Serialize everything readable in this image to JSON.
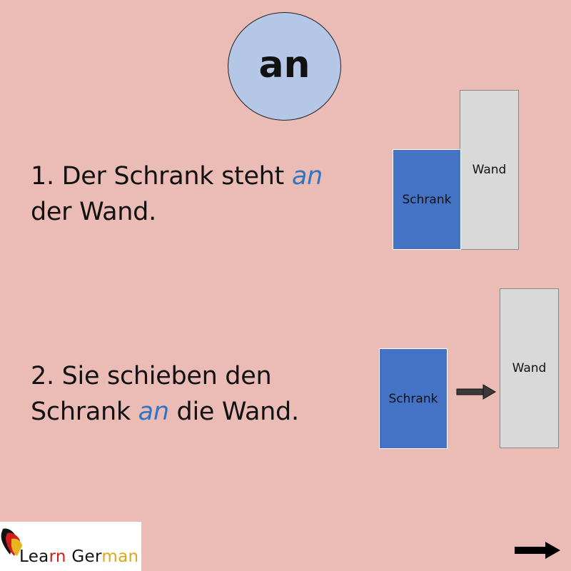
{
  "title": "an",
  "sentence1": {
    "number": "1.",
    "before": "Der Schrank steht",
    "keyword": "an",
    "after": "der Wand."
  },
  "sentence2": {
    "number": "2.",
    "before_line1": "Sie schieben den",
    "before_line2": "Schrank",
    "keyword": "an",
    "after": "die Wand."
  },
  "diagram1": {
    "schrank_label": "Schrank",
    "wand_label": "Wand"
  },
  "diagram2": {
    "schrank_label": "Schrank",
    "wand_label": "Wand"
  },
  "logo": {
    "part1": "Lea",
    "part2": "rn",
    "part3": "Ger",
    "part4": "man"
  },
  "icons": {
    "direction": "arrow-right-icon",
    "next": "next-arrow-icon",
    "logo": "germany-heart-icon"
  },
  "colors": {
    "background": "#ebbbb6",
    "circle": "#b4c7e7",
    "keyword": "#2e75c4",
    "schrank": "#4472c4",
    "wand": "#d9d9d9"
  }
}
